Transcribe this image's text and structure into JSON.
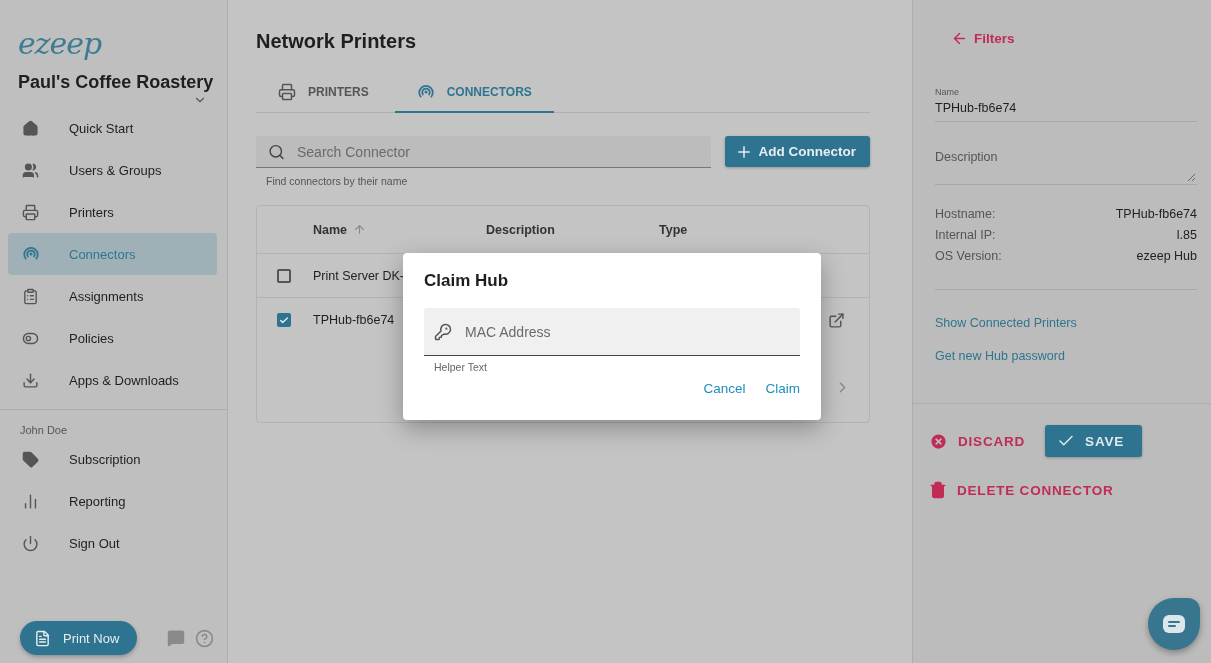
{
  "logo": "ezeep",
  "organization": "Paul's Coffee Roastery",
  "nav": [
    {
      "label": "Quick Start",
      "selected": false
    },
    {
      "label": "Users & Groups",
      "selected": false
    },
    {
      "label": "Printers",
      "selected": false
    },
    {
      "label": "Connectors",
      "selected": true
    },
    {
      "label": "Assignments",
      "selected": false
    },
    {
      "label": "Policies",
      "selected": false
    },
    {
      "label": "Apps & Downloads",
      "selected": false
    }
  ],
  "user_section": {
    "label": "John Doe",
    "items": [
      {
        "label": "Subscription"
      },
      {
        "label": "Reporting"
      },
      {
        "label": "Sign Out"
      }
    ]
  },
  "print_button": "Print Now",
  "page_title": "Network Printers",
  "tabs": [
    {
      "label": "PRINTERS",
      "selected": false
    },
    {
      "label": "CONNECTORS",
      "selected": true
    }
  ],
  "search": {
    "placeholder": "Search Connector",
    "helper": "Find connectors by their name"
  },
  "add_button": "Add Connector",
  "table": {
    "columns": [
      "Name",
      "Description",
      "Type"
    ],
    "rows": [
      {
        "name": "Print Server DK-",
        "checked": false
      },
      {
        "name": "TPHub-fb6e74",
        "checked": true
      }
    ]
  },
  "dialog": {
    "title": "Claim Hub",
    "field": {
      "placeholder": "MAC Address",
      "helper": "Helper Text"
    },
    "actions": [
      "Cancel",
      "Claim"
    ]
  },
  "details": {
    "back": "Filters",
    "name_label": "Name",
    "name_value": "TPHub-fb6e74",
    "description_placeholder": "Description",
    "properties": [
      {
        "label": "Hostname:",
        "value": "TPHub-fb6e74"
      },
      {
        "label": "Internal IP:",
        "value": "l.85"
      },
      {
        "label": "OS Version:",
        "value": "ezeep Hub"
      }
    ],
    "links": [
      "Show Connected Printers",
      "Get new Hub password"
    ],
    "discard": "DISCARD",
    "save": "SAVE",
    "delete": "DELETE CONNECTOR"
  }
}
